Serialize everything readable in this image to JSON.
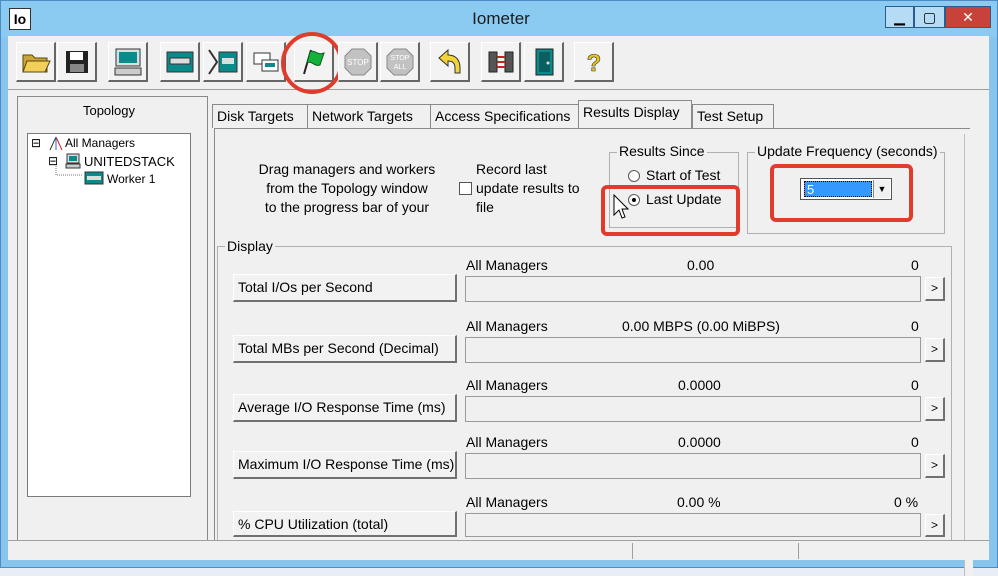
{
  "window": {
    "app_icon": "Io",
    "title": "Iometer",
    "min_glyph": "▁",
    "max_glyph": "▢",
    "close_glyph": "✕"
  },
  "toolbar": {
    "buttons": [
      {
        "name": "open-config-button",
        "icon": "folder-open-icon"
      },
      {
        "name": "save-config-button",
        "icon": "floppy-disk-icon"
      },
      {
        "name": "new-manager-button",
        "icon": "computer-icon"
      },
      {
        "name": "new-disk-worker-button",
        "icon": "disk-worker-icon"
      },
      {
        "name": "new-network-worker-button",
        "icon": "network-worker-icon"
      },
      {
        "name": "copy-worker-button",
        "icon": "copy-worker-icon"
      },
      {
        "name": "start-tests-button",
        "icon": "green-flag-icon"
      },
      {
        "name": "stop-button",
        "icon": "stop-sign-icon",
        "label": "STOP"
      },
      {
        "name": "stop-all-button",
        "icon": "stop-all-sign-icon",
        "label": "STOP ALL"
      },
      {
        "name": "reset-workers-button",
        "icon": "reset-arrow-icon"
      },
      {
        "name": "disconnect-button",
        "icon": "disconnect-icon"
      },
      {
        "name": "exit-button",
        "icon": "exit-door-icon"
      },
      {
        "name": "help-button",
        "icon": "help-question-icon",
        "label": "?"
      }
    ]
  },
  "topology": {
    "title": "Topology",
    "tree": [
      {
        "label": "All Managers",
        "expander": "⊟"
      },
      {
        "label": "UNITEDSTACK",
        "expander": "⊟"
      },
      {
        "label": "Worker 1"
      }
    ]
  },
  "tabs": [
    {
      "label": "Disk Targets"
    },
    {
      "label": "Network Targets"
    },
    {
      "label": "Access Specifications"
    },
    {
      "label": "Results Display",
      "active": true
    },
    {
      "label": "Test Setup"
    }
  ],
  "results": {
    "drag_hint_lines": [
      "Drag managers and workers",
      "from the Topology window",
      "to the progress bar of your"
    ],
    "record_last_lines": [
      "Record last",
      "update results to",
      "file"
    ],
    "results_since": {
      "legend": "Results Since",
      "options": [
        "Start of Test",
        "Last Update"
      ],
      "selected": "Last Update"
    },
    "update_frequency": {
      "legend": "Update Frequency (seconds)",
      "value": "5"
    },
    "display_legend": "Display",
    "metrics": [
      {
        "label": "Total I/Os per Second",
        "target": "All Managers",
        "value": "0.00",
        "max": "0"
      },
      {
        "label": "Total MBs per Second (Decimal)",
        "target": "All Managers",
        "value": "0.00 MBPS (0.00 MiBPS)",
        "max": "0"
      },
      {
        "label": "Average I/O Response Time (ms)",
        "target": "All Managers",
        "value": "0.0000",
        "max": "0"
      },
      {
        "label": "Maximum I/O Response Time (ms)",
        "target": "All Managers",
        "value": "0.0000",
        "max": "0"
      },
      {
        "label": "% CPU Utilization (total)",
        "target": "All Managers",
        "value": "0.00 %",
        "max": "0 %"
      }
    ],
    "more_glyph": ">"
  },
  "colors": {
    "annotation_red": "#e13b2e",
    "selection_blue": "#3399ff",
    "titlebar_blue": "#8ccbf1"
  }
}
